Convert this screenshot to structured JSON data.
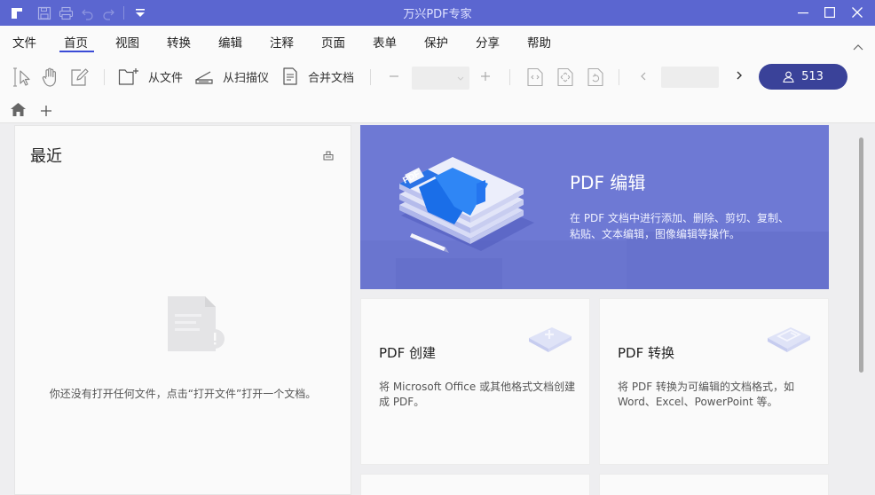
{
  "app": {
    "title": "万兴PDF专家"
  },
  "menu": {
    "items": [
      "文件",
      "首页",
      "视图",
      "转换",
      "编辑",
      "注释",
      "页面",
      "表单",
      "保护",
      "分享",
      "帮助"
    ],
    "active": "首页"
  },
  "toolbar": {
    "from_file": "从文件",
    "from_scanner": "从扫描仪",
    "merge_docs": "合并文档",
    "zoom_value": "",
    "page_value": "",
    "user_count": "513"
  },
  "recent": {
    "title": "最近",
    "empty_message": "你还没有打开任何文件，点击“打开文件”打开一个文档。"
  },
  "hero": {
    "title": "PDF 编辑",
    "description": "在 PDF 文档中进行添加、删除、剪切、复制、粘贴、文本编辑，图像编辑等操作。",
    "badge": "PDF"
  },
  "cards": {
    "create": {
      "title": "PDF 创建",
      "description": "将 Microsoft Office 或其他格式文档创建成 PDF。"
    },
    "convert": {
      "title": "PDF 转换",
      "description": "将 PDF 转换为可编辑的文档格式，如 Word、Excel、PowerPoint 等。"
    }
  },
  "colors": {
    "titlebar": "#5b66d0",
    "hero": "#6e79d4",
    "user_button": "#3a4299",
    "accent_underline": "#3b4bd6"
  }
}
